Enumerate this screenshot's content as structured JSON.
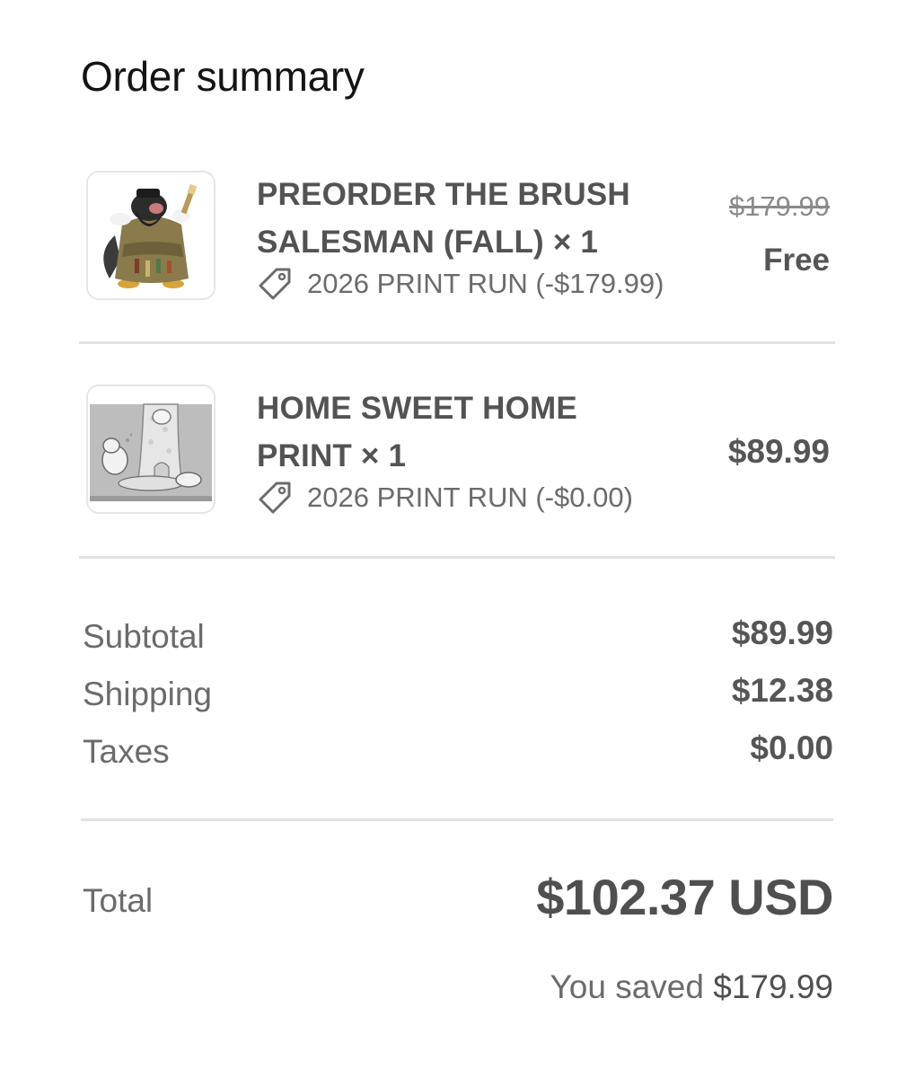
{
  "page_title": "Order summary",
  "line_items": [
    {
      "title_line1": "PREORDER THE BRUSH",
      "title_line2": "SALESMAN (FALL) × 1",
      "discount": "2026 PRINT RUN (-$179.99)",
      "original_price": "$179.99",
      "price": "Free",
      "thumbnail": "brush-salesman-figure-image"
    },
    {
      "title_line1": "HOME SWEET HOME",
      "title_line2": "PRINT × 1",
      "discount": "2026 PRINT RUN (-$0.00)",
      "price": "$89.99",
      "thumbnail": "home-sweet-home-print-image"
    }
  ],
  "summary": {
    "subtotal_label": "Subtotal",
    "subtotal_value": "$89.99",
    "shipping_label": "Shipping",
    "shipping_value": "$12.38",
    "taxes_label": "Taxes",
    "taxes_value": "$0.00"
  },
  "total": {
    "label": "Total",
    "value": "$102.37 USD"
  },
  "savings": {
    "prefix": "You saved",
    "amount": "$179.99"
  },
  "colors": {
    "text_dark": "#141414",
    "text_primary": "#555555",
    "text_secondary": "#6b6b6b",
    "divider": "#e2e2e2"
  }
}
